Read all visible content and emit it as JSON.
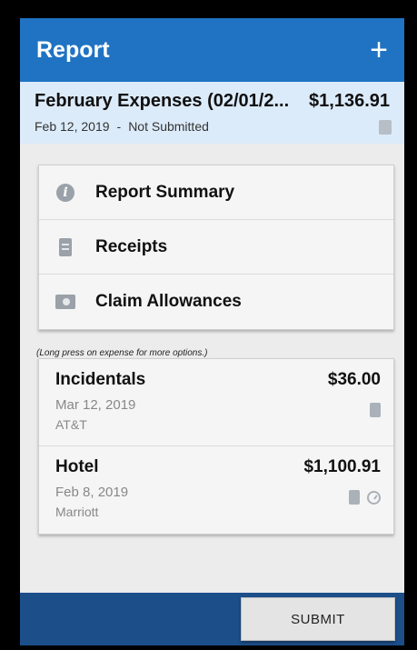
{
  "appbar": {
    "title": "Report",
    "add_icon": "plus-icon"
  },
  "report": {
    "title": "February Expenses (02/01/2...",
    "amount": "$1,136.91",
    "date": "Feb 12, 2019",
    "separator": "-",
    "status": "Not Submitted",
    "icon": "receipt-icon"
  },
  "menu": {
    "items": [
      {
        "label": "Report Summary",
        "icon": "info-icon"
      },
      {
        "label": "Receipts",
        "icon": "receipt-icon"
      },
      {
        "label": "Claim Allowances",
        "icon": "money-icon"
      }
    ]
  },
  "hint": "(Long press on expense for more options.)",
  "expenses": [
    {
      "name": "Incidentals",
      "amount": "$36.00",
      "date": "Mar 12, 2019",
      "vendor": "AT&T",
      "icons": [
        "receipt-icon"
      ]
    },
    {
      "name": "Hotel",
      "amount": "$1,100.91",
      "date": "Feb 8, 2019",
      "vendor": "Marriott",
      "icons": [
        "receipt-icon",
        "clock-icon"
      ]
    }
  ],
  "footer": {
    "submit_label": "SUBMIT"
  },
  "colors": {
    "appbar": "#1f73c2",
    "header_bg": "#dcebfa",
    "footer": "#1c4f8a"
  }
}
